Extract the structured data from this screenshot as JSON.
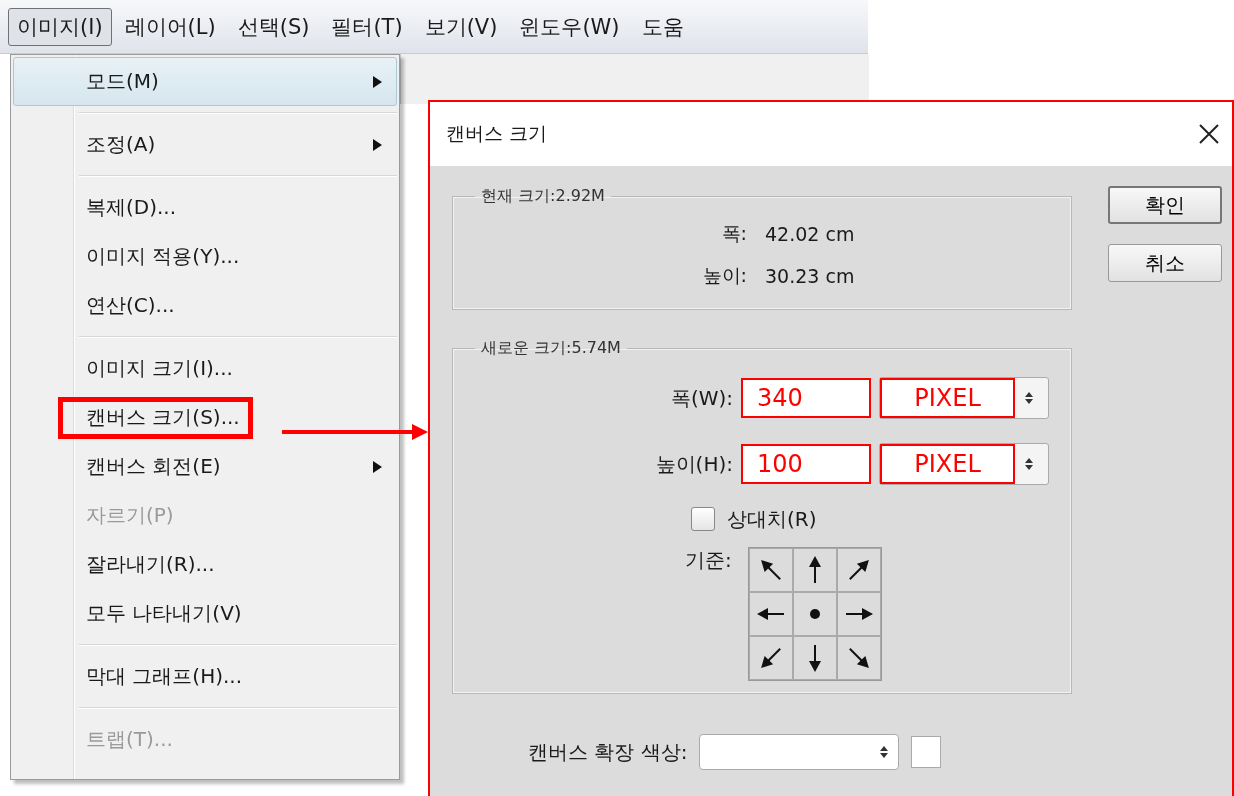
{
  "menu_bar": {
    "items": [
      {
        "label": "이미지(I)",
        "selected": true
      },
      {
        "label": "레이어(L)",
        "selected": false
      },
      {
        "label": "선택(S)",
        "selected": false
      },
      {
        "label": "필터(T)",
        "selected": false
      },
      {
        "label": "보기(V)",
        "selected": false
      },
      {
        "label": "윈도우(W)",
        "selected": false
      },
      {
        "label": "도움",
        "selected": false
      }
    ]
  },
  "image_menu": {
    "groups": [
      [
        {
          "label": "모드(M)",
          "kind": "submenu",
          "selected": true,
          "disabled": false,
          "annotated": false
        }
      ],
      [
        {
          "label": "조정(A)",
          "kind": "submenu",
          "selected": false,
          "disabled": false,
          "annotated": false
        }
      ],
      [
        {
          "label": "복제(D)...",
          "kind": "item",
          "selected": false,
          "disabled": false,
          "annotated": false
        },
        {
          "label": "이미지 적용(Y)...",
          "kind": "item",
          "selected": false,
          "disabled": false,
          "annotated": false
        },
        {
          "label": "연산(C)...",
          "kind": "item",
          "selected": false,
          "disabled": false,
          "annotated": false
        }
      ],
      [
        {
          "label": "이미지 크기(I)...",
          "kind": "item",
          "selected": false,
          "disabled": false,
          "annotated": false
        },
        {
          "label": "캔버스 크기(S)...",
          "kind": "item",
          "selected": false,
          "disabled": false,
          "annotated": true
        },
        {
          "label": "캔버스 회전(E)",
          "kind": "submenu",
          "selected": false,
          "disabled": false,
          "annotated": false
        },
        {
          "label": "자르기(P)",
          "kind": "item",
          "selected": false,
          "disabled": true,
          "annotated": false
        },
        {
          "label": "잘라내기(R)...",
          "kind": "item",
          "selected": false,
          "disabled": false,
          "annotated": false
        },
        {
          "label": "모두 나타내기(V)",
          "kind": "item",
          "selected": false,
          "disabled": false,
          "annotated": false
        }
      ],
      [
        {
          "label": "막대 그래프(H)...",
          "kind": "item",
          "selected": false,
          "disabled": false,
          "annotated": false
        }
      ],
      [
        {
          "label": "트랩(T)...",
          "kind": "item",
          "selected": false,
          "disabled": true,
          "annotated": false
        }
      ]
    ]
  },
  "dialog": {
    "title": "캔버스 크기",
    "current_size": {
      "legend": "현재 크기:2.92M",
      "rows": [
        {
          "label": "폭:",
          "value": "42.02 cm"
        },
        {
          "label": "높이:",
          "value": "30.23 cm"
        }
      ]
    },
    "new_size": {
      "legend": "새로운 크기:5.74M",
      "fields": [
        {
          "label": "폭(W):",
          "value": "340",
          "unit": "PIXEL"
        },
        {
          "label": "높이(H):",
          "value": "100",
          "unit": "PIXEL"
        }
      ],
      "relative": {
        "label": "상대치(R)",
        "checked": false
      },
      "anchor": {
        "label": "기준:"
      }
    },
    "extension_color": {
      "label": "캔버스 확장 색상:"
    },
    "buttons": [
      {
        "label": "확인",
        "default": true
      },
      {
        "label": "취소",
        "default": false
      }
    ]
  }
}
